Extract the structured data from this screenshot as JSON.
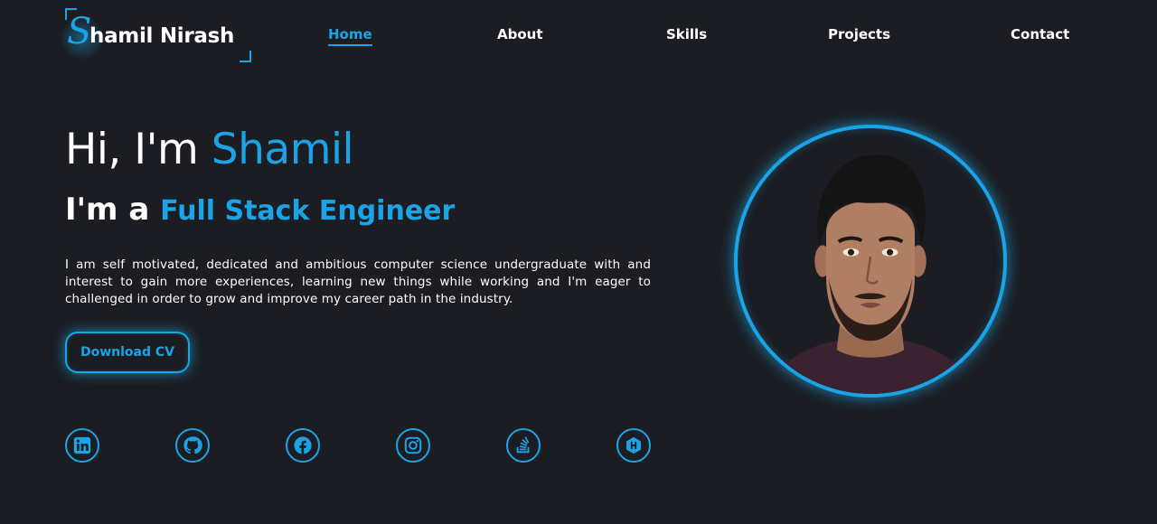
{
  "logo": {
    "initial": "S",
    "rest": "hamil Nirash"
  },
  "nav": {
    "home": "Home",
    "about": "About",
    "skills": "Skills",
    "projects": "Projects",
    "contact": "Contact"
  },
  "hero": {
    "greeting_prefix": "Hi, I'm ",
    "name": "Shamil",
    "role_prefix": "I'm a ",
    "role": "Full Stack Engineer",
    "bio": "I am self motivated, dedicated and ambitious computer science undergraduate with and interest to gain more experiences, learning new things while working and I'm eager to challenged in order to grow and improve my career path in the industry.",
    "cv_button": "Download CV"
  },
  "social_icons": [
    "linkedin-icon",
    "github-icon",
    "facebook-icon",
    "instagram-icon",
    "stackoverflow-icon",
    "hashnode-icon"
  ],
  "profile": {
    "image": "profile-photo"
  },
  "colors": {
    "background": "#1b1d22",
    "accent": "#1aa4e6",
    "text": "#ffffff"
  }
}
